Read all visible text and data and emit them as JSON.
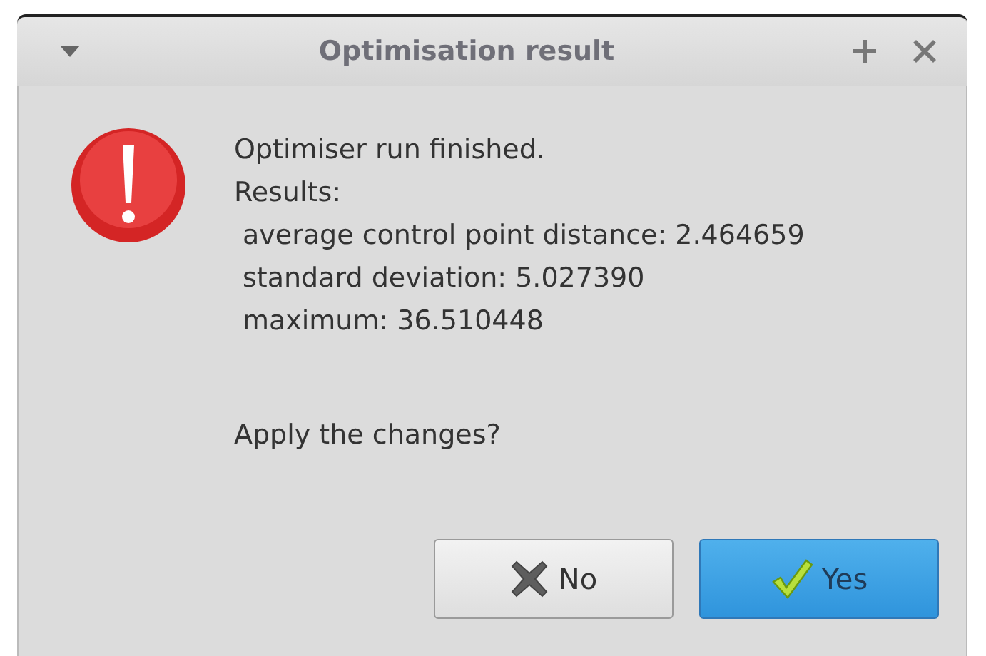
{
  "window": {
    "title": "Optimisation result"
  },
  "message": {
    "lines": [
      "Optimiser run finished.",
      "Results:"
    ],
    "details": [
      "average control point distance: 2.464659",
      "standard deviation: 5.027390",
      "maximum: 36.510448"
    ],
    "question": "Apply the changes?"
  },
  "buttons": [
    {
      "label": "No",
      "kind": "reject",
      "default": false
    },
    {
      "label": "Yes",
      "kind": "accept",
      "default": true
    }
  ]
}
